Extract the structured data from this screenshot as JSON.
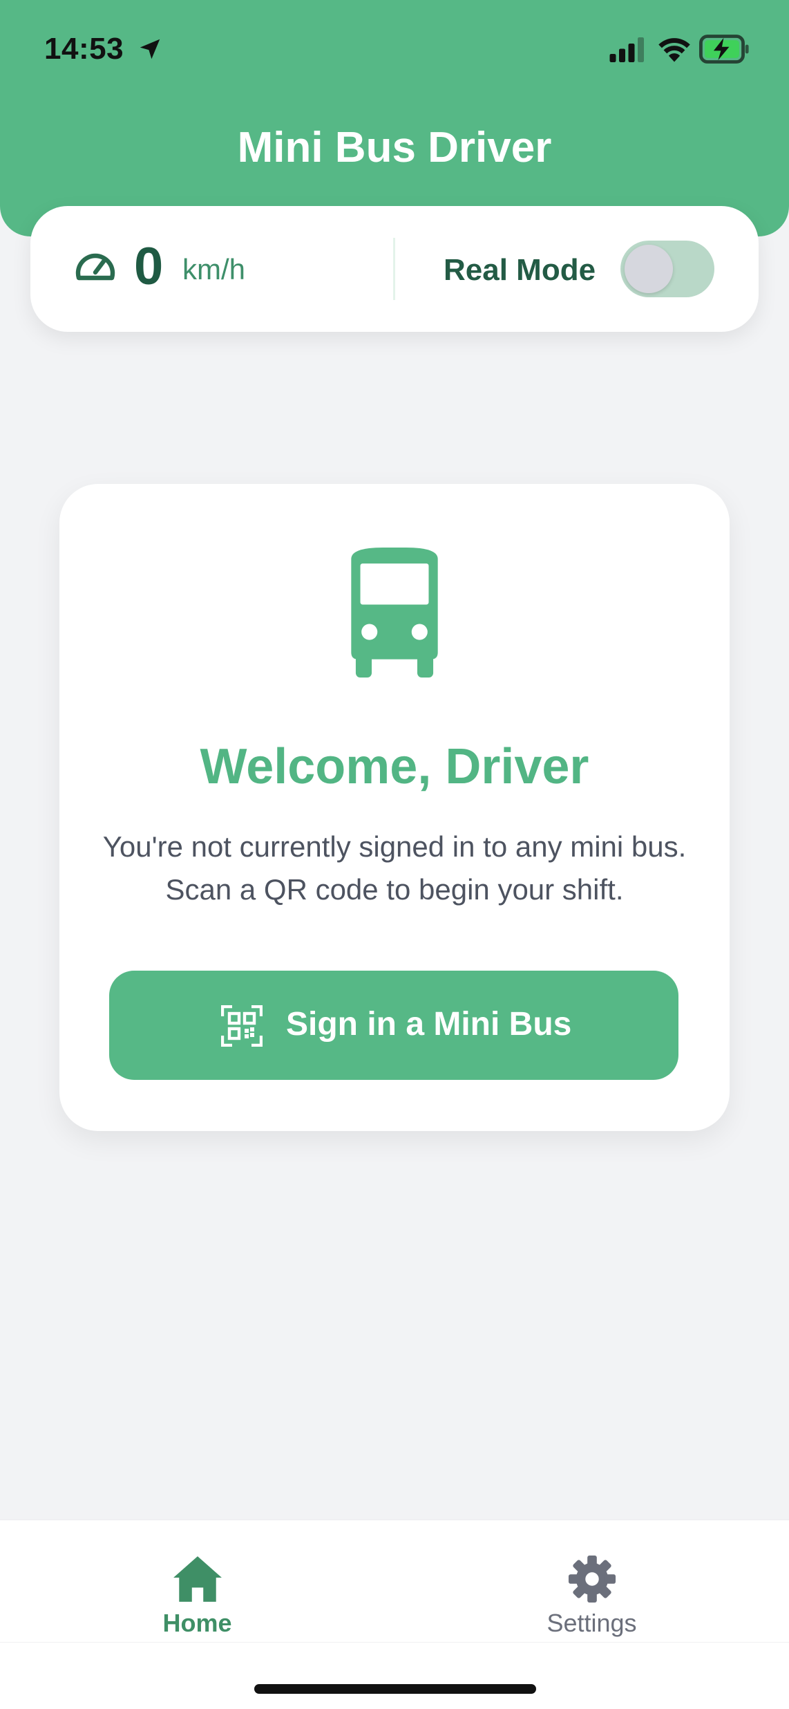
{
  "status_bar": {
    "time": "14:53",
    "icons": [
      "location-arrow-icon",
      "cellular-signal-icon",
      "wifi-icon",
      "battery-charging-icon"
    ]
  },
  "header": {
    "title": "Mini Bus Driver",
    "color": "#56b886"
  },
  "speed_card": {
    "icon": "speedometer-icon",
    "speed_value": "0",
    "speed_unit": "km/h",
    "mode_label": "Real Mode",
    "toggle_on": false
  },
  "welcome_card": {
    "icon": "bus-icon",
    "title": "Welcome, Driver",
    "message": "You're not currently signed in to any mini bus. Scan a QR code to begin your shift.",
    "button_icon": "qr-code-icon",
    "button_label": "Sign in a Mini Bus"
  },
  "tab_bar": {
    "tabs": [
      {
        "label": "Home",
        "icon": "home-icon",
        "active": true
      },
      {
        "label": "Settings",
        "icon": "gear-icon",
        "active": false
      }
    ]
  },
  "colors": {
    "accent": "#56b886",
    "text_dark_green": "#1f5a43",
    "body_text": "#4d5360",
    "background": "#f2f3f5"
  }
}
